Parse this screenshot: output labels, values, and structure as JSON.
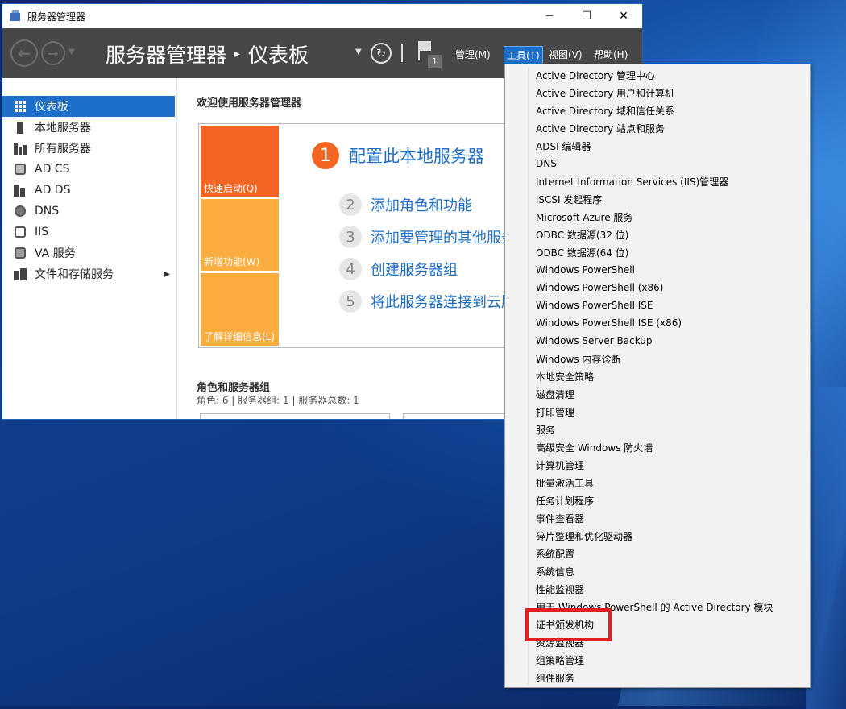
{
  "window": {
    "title": "服务器管理器",
    "controls": [
      "─",
      "☐",
      "✕"
    ]
  },
  "header": {
    "breadcrumb_app": "服务器管理器",
    "breadcrumb_sep": "▸",
    "breadcrumb_page": "仪表板",
    "notification_count": "1",
    "menus": [
      "管理(M)",
      "工具(T)",
      "视图(V)",
      "帮助(H)"
    ]
  },
  "sidebar": {
    "items": [
      {
        "label": "仪表板",
        "icon": "dashboard-icon"
      },
      {
        "label": "本地服务器",
        "icon": "server-icon"
      },
      {
        "label": "所有服务器",
        "icon": "servers-icon"
      },
      {
        "label": "AD CS",
        "icon": "adcs-icon"
      },
      {
        "label": "AD DS",
        "icon": "adds-icon"
      },
      {
        "label": "DNS",
        "icon": "dns-icon"
      },
      {
        "label": "IIS",
        "icon": "iis-icon"
      },
      {
        "label": "VA 服务",
        "icon": "va-icon"
      },
      {
        "label": "文件和存储服务",
        "icon": "storage-icon"
      }
    ]
  },
  "main": {
    "welcome": "欢迎使用服务器管理器",
    "tiles": [
      "快速启动(Q)",
      "新增功能(W)",
      "了解详细信息(L)"
    ],
    "steps": [
      {
        "num": "1",
        "text": "配置此本地服务器"
      },
      {
        "num": "2",
        "text": "添加角色和功能"
      },
      {
        "num": "3",
        "text": "添加要管理的其他服务器"
      },
      {
        "num": "4",
        "text": "创建服务器组"
      },
      {
        "num": "5",
        "text": "将此服务器连接到云服务"
      }
    ],
    "roles_title": "角色和服务器组",
    "roles_sub": "角色: 6 | 服务器组: 1 | 服务器总数: 1"
  },
  "tools_menu": {
    "items": [
      "Active Directory 管理中心",
      "Active Directory 用户和计算机",
      "Active Directory 域和信任关系",
      "Active Directory 站点和服务",
      "ADSI 编辑器",
      "DNS",
      "Internet Information Services (IIS)管理器",
      "iSCSI 发起程序",
      "Microsoft Azure 服务",
      "ODBC 数据源(32 位)",
      "ODBC 数据源(64 位)",
      "Windows PowerShell",
      "Windows PowerShell (x86)",
      "Windows PowerShell ISE",
      "Windows PowerShell ISE (x86)",
      "Windows Server Backup",
      "Windows 内存诊断",
      "本地安全策略",
      "磁盘清理",
      "打印管理",
      "服务",
      "高级安全 Windows 防火墙",
      "计算机管理",
      "批量激活工具",
      "任务计划程序",
      "事件查看器",
      "碎片整理和优化驱动器",
      "系统配置",
      "系统信息",
      "性能监视器",
      "用于 Windows PowerShell 的 Active Directory 模块",
      "证书颁发机构",
      "资源监视器",
      "组策略管理",
      "组件服务"
    ]
  },
  "colors": {
    "accent": "#1e6fc7",
    "orange": "#f26522",
    "amber": "#fbad3f",
    "header_bg": "#474747",
    "highlight": "#e0201c"
  }
}
